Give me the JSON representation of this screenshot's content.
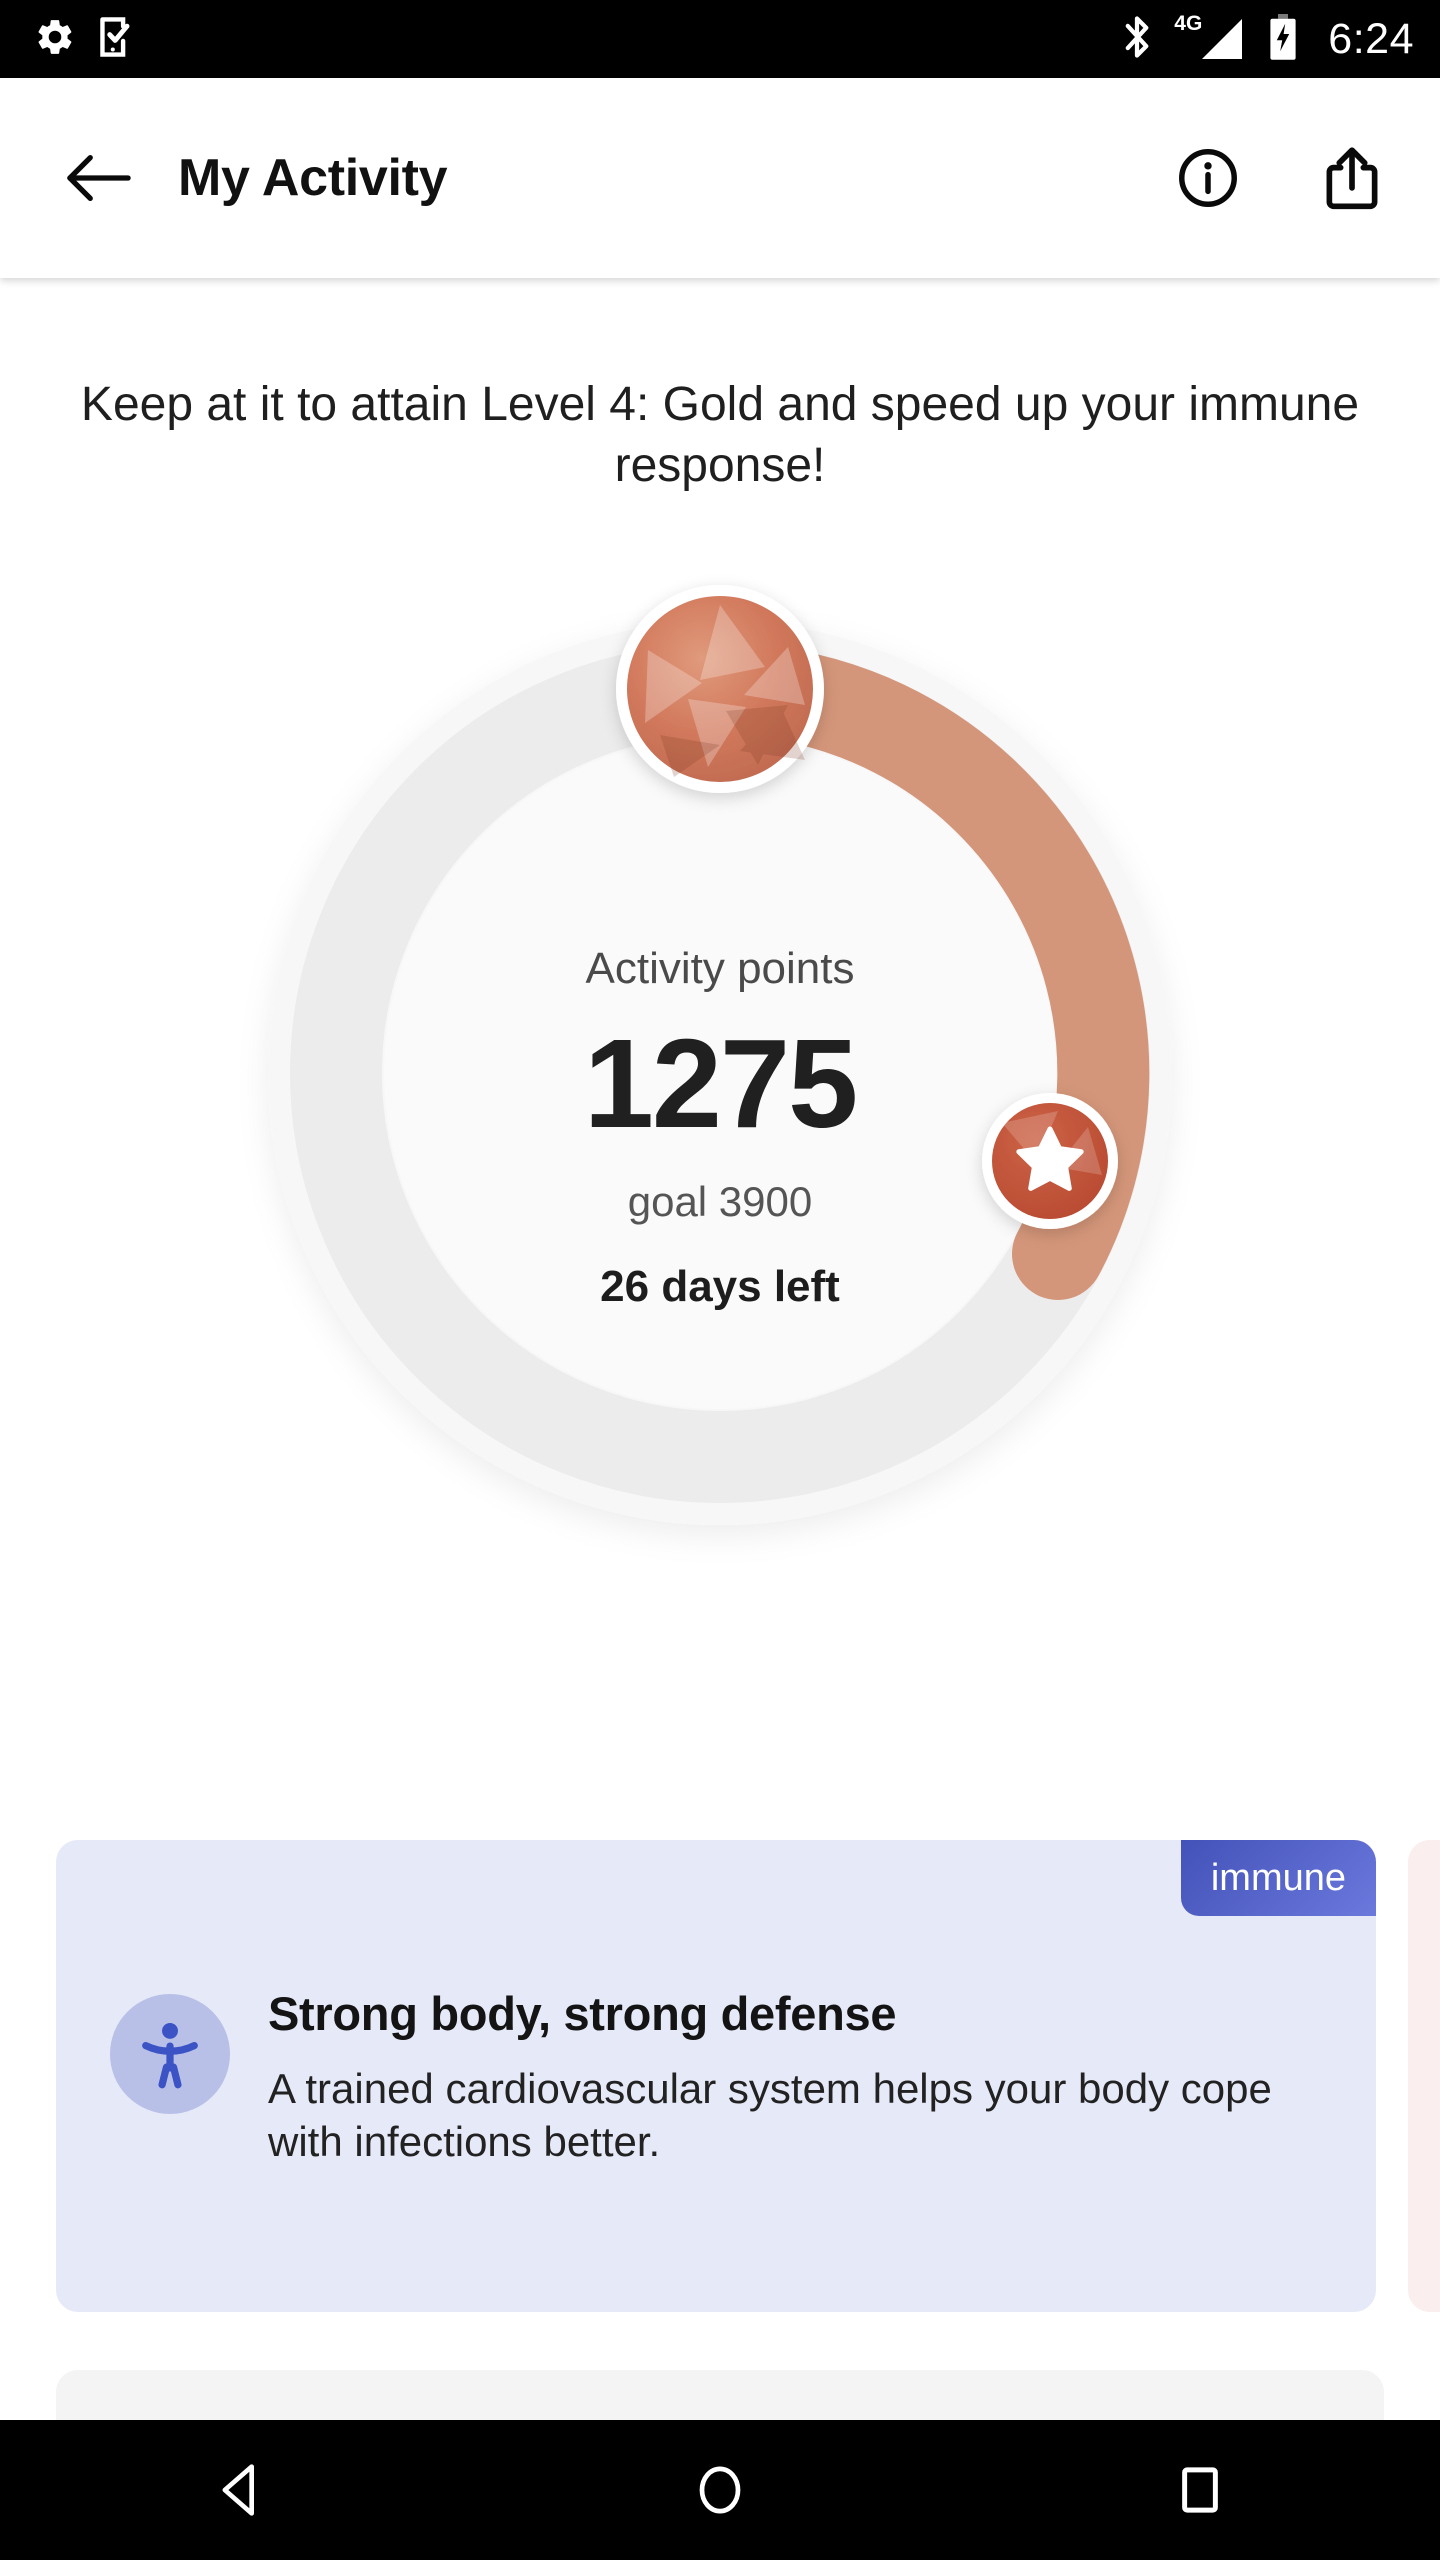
{
  "status_bar": {
    "time": "6:24",
    "network_label": "4G",
    "icons": [
      "settings-gear-icon",
      "phone-check-icon",
      "bluetooth-icon",
      "signal-4g-icon",
      "battery-charging-icon"
    ]
  },
  "app_bar": {
    "title": "My Activity",
    "back_icon": "back-arrow-icon",
    "info_icon": "info-circle-icon",
    "share_icon": "share-icon"
  },
  "main": {
    "headline": "Keep at it to attain Level 4: Gold and speed up your immune response!",
    "ring": {
      "points_label": "Activity points",
      "points_value": "1275",
      "goal_label": "goal 3900",
      "days_left": "26 days left",
      "gem_icon": "bronze-gem-icon",
      "milestone_icon": "star-icon"
    }
  },
  "cards": [
    {
      "badge": "immune",
      "title": "Strong body, strong defense",
      "body": "A trained cardiovascular system helps your body cope with infections better.",
      "icon": "accessibility-icon"
    },
    {
      "badge": "",
      "title": "",
      "body": "",
      "icon": ""
    }
  ],
  "nav_bar": {
    "back": "nav-back-icon",
    "home": "nav-home-icon",
    "recents": "nav-recents-icon"
  },
  "chart_data": {
    "type": "progress-ring",
    "title": "Activity points",
    "value": 1275,
    "goal": 3900,
    "unit": "points",
    "percent": 32.7,
    "arc_start_deg": 0,
    "arc_sweep_deg": 118,
    "track_color": "#ececec",
    "progress_color": "#d4967a",
    "milestone_marker_deg": 75,
    "annotations": [
      "goal 3900",
      "26 days left"
    ]
  },
  "colors": {
    "progress": "#d4967a",
    "track": "#ececec",
    "outer_disc": "#f6f6f6",
    "inner_disc": "#fafafa",
    "badge_start": "#4352b8",
    "badge_end": "#6b79dd",
    "card_bg": "#e6e9f8",
    "card_peek_bg": "#faeeee",
    "card_icon_bg": "#b9c0e8",
    "card_icon_fg": "#3b53c4",
    "star_circle": "#c1553a"
  }
}
